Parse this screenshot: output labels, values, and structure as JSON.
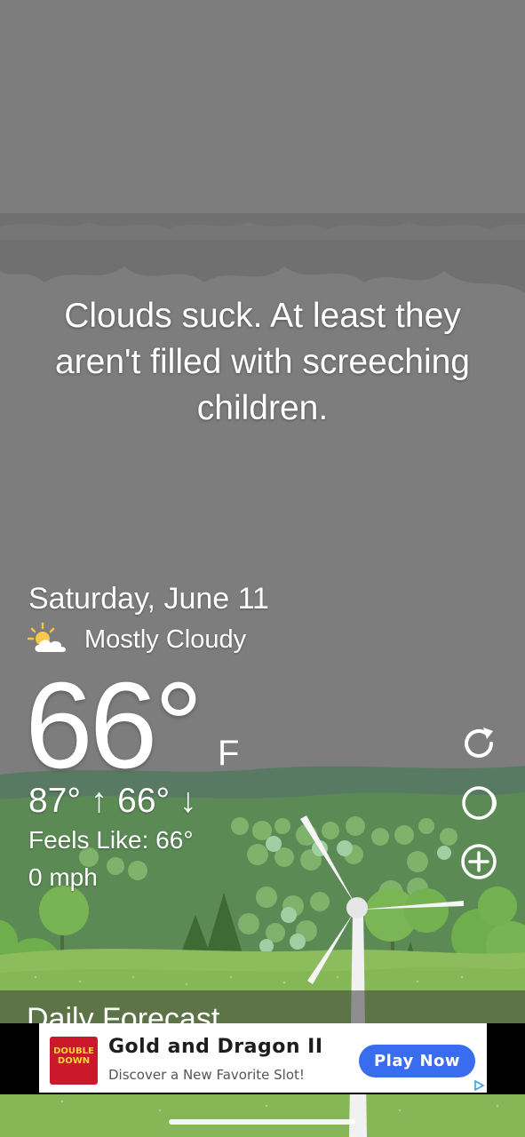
{
  "quote": "Clouds suck. At least they aren't filled with screeching children.",
  "weather": {
    "date": "Saturday, June 11",
    "condition_icon": "partly-cloudy-icon",
    "condition": "Mostly Cloudy",
    "temperature": "66°",
    "unit": "F",
    "hi_lo": "87° ↑  66° ↓",
    "feels_like": "Feels Like: 66°",
    "wind": "0 mph"
  },
  "actions": {
    "refresh_icon": "refresh-icon",
    "moon_icon": "moon-phase-icon",
    "add_icon": "add-location-icon"
  },
  "daily_forecast_label": "Daily Forecast",
  "ad": {
    "logo_text": "DOUBLE DOWN",
    "title": "Gold and Dragon II",
    "subtitle": "Discover a New Favorite Slot!",
    "cta": "Play Now"
  },
  "colors": {
    "sky": "#7d7d7d",
    "hills": "#5f9a4a",
    "cta": "#3a6cf0"
  }
}
